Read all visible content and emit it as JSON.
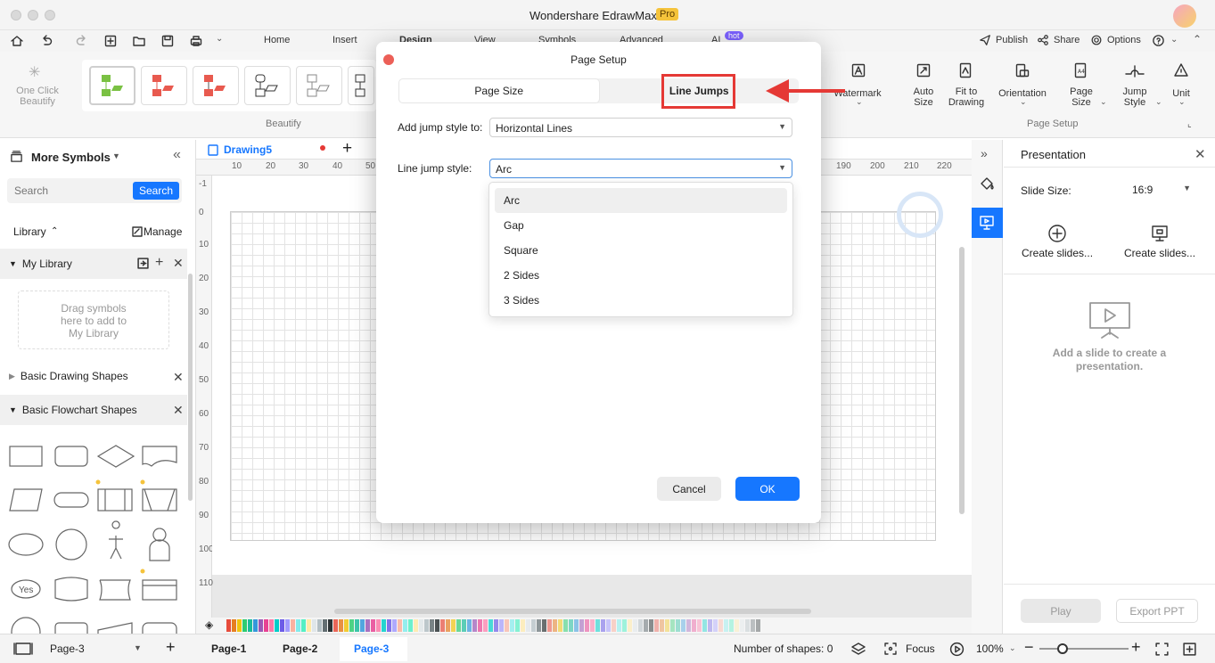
{
  "app": {
    "title": "Wondershare EdrawMax",
    "badge": "Pro"
  },
  "menu": {
    "tabs": [
      "Home",
      "Insert",
      "Design",
      "View",
      "Symbols",
      "Advanced",
      "AI"
    ],
    "ai_badge": "hot",
    "publish": "Publish",
    "share": "Share",
    "options": "Options"
  },
  "ribbon": {
    "one_click": "One Click",
    "beautify": "Beautify",
    "beautify_group": "Beautify",
    "watermark": "Watermark",
    "auto_size": [
      "Auto",
      "Size"
    ],
    "fit_to_drawing": [
      "Fit to",
      "Drawing"
    ],
    "orientation": "Orientation",
    "page_size": [
      "Page",
      "Size"
    ],
    "jump_style": [
      "Jump",
      "Style"
    ],
    "unit": "Unit",
    "page_setup_group": "Page Setup"
  },
  "left": {
    "more_symbols": "More Symbols",
    "search_placeholder": "Search",
    "search_button": "Search",
    "library": "Library",
    "manage": "Manage",
    "my_library": "My Library",
    "drop_hint": [
      "Drag symbols",
      "here to add to",
      "My Library"
    ],
    "basic_drawing": "Basic Drawing Shapes",
    "basic_flowchart": "Basic Flowchart Shapes",
    "yes_label": "Yes"
  },
  "canvas": {
    "doc_tab": "Drawing5",
    "ruler_h": [
      "10",
      "20",
      "30",
      "40",
      "50",
      "190",
      "200",
      "210",
      "220"
    ],
    "ruler_v": [
      "-1",
      "0",
      "10",
      "20",
      "30",
      "40",
      "50",
      "60",
      "70",
      "80",
      "90",
      "100",
      "110"
    ]
  },
  "right": {
    "title": "Presentation",
    "slide_size_label": "Slide Size:",
    "slide_size_value": "16:9",
    "create1": "Create slides...",
    "create2": "Create slides...",
    "empty_text": [
      "Add a slide to create a",
      "presentation."
    ],
    "play": "Play",
    "export": "Export PPT"
  },
  "bottom": {
    "page_select": "Page-3",
    "pages": [
      "Page-1",
      "Page-2",
      "Page-3"
    ],
    "shapes": "Number of shapes: 0",
    "focus": "Focus",
    "zoom": "100%"
  },
  "dialog": {
    "title": "Page Setup",
    "tab_page_size": "Page Size",
    "tab_line_jumps": "Line Jumps",
    "add_jump_label": "Add jump style to:",
    "add_jump_value": "Horizontal Lines",
    "line_jump_label": "Line jump style:",
    "line_jump_value": "Arc",
    "options": [
      "Arc",
      "Gap",
      "Square",
      "2 Sides",
      "3 Sides"
    ],
    "cancel": "Cancel",
    "ok": "OK"
  },
  "colors": {
    "accent": "#1677ff",
    "annotation": "#e53935"
  }
}
